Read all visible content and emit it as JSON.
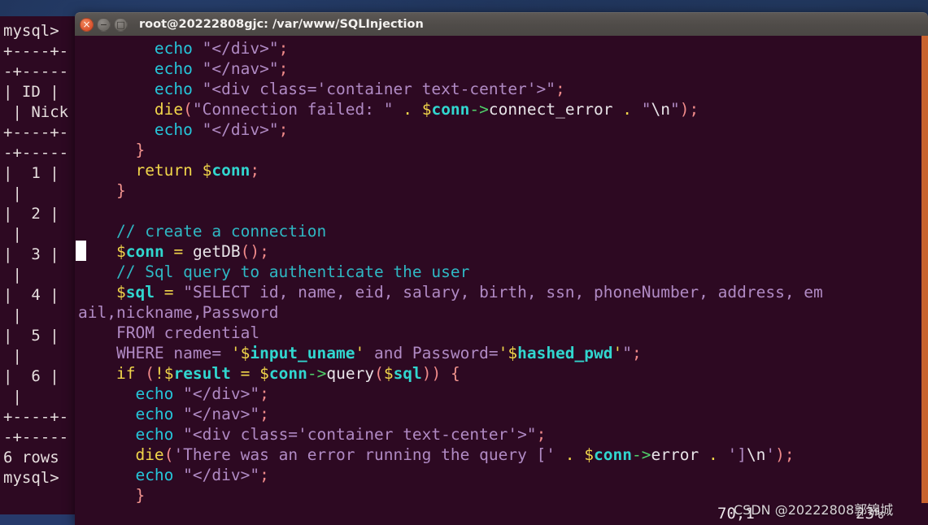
{
  "window": {
    "title": "root@20222808gjc: /var/www/SQLInjection",
    "controls": {
      "close": "×",
      "minimize": "−",
      "maximize": "□"
    },
    "colors": {
      "titlebar": "#4f4b48",
      "terminal_bg": "#2d0922",
      "accent_orange": "#c8622e",
      "desktop": "#1a2a4b"
    }
  },
  "background_terminal": {
    "lines": [
      "mysql>",
      "+----+-",
      "-+-----",
      "| ID |",
      " | Nick",
      "+----+-",
      "-+-----",
      "|  1 |",
      " |",
      "|  2 |",
      " |",
      "|  3 |",
      " |",
      "|  4 |",
      " |",
      "|  5 |",
      " |",
      "|  6 |",
      " |",
      "+----+-",
      "-+-----",
      "6 rows",
      "",
      "mysql>"
    ]
  },
  "editor": {
    "lines": [
      "        echo \"</div>\";",
      "        echo \"</nav>\";",
      "        echo \"<div class='container text-center'>\";",
      "        die(\"Connection failed: \" . $conn->connect_error . \"\\n\");",
      "        echo \"</div>\";",
      "      }",
      "      return $conn;",
      "    }",
      "",
      "    // create a connection",
      "    $conn = getDB();",
      "    // Sql query to authenticate the user",
      "    $sql = \"SELECT id, name, eid, salary, birth, ssn, phoneNumber, address, email,nickname,Password",
      "    FROM credential",
      "    WHERE name= '$input_uname' and Password='$hashed_pwd'\";",
      "    if (!$result = $conn->query($sql)) {",
      "        echo \"</div>\";",
      "        echo \"</nav>\";",
      "        echo \"<div class='container text-center'>\";",
      "        die('There was an error running the query [' . $conn->error . ']\\n');",
      "        echo \"</div>\";",
      "      }"
    ]
  },
  "statusline": {
    "position": "70,1",
    "percent": "23%"
  },
  "watermark": {
    "text": "CSDN @20222808郭锦城"
  }
}
